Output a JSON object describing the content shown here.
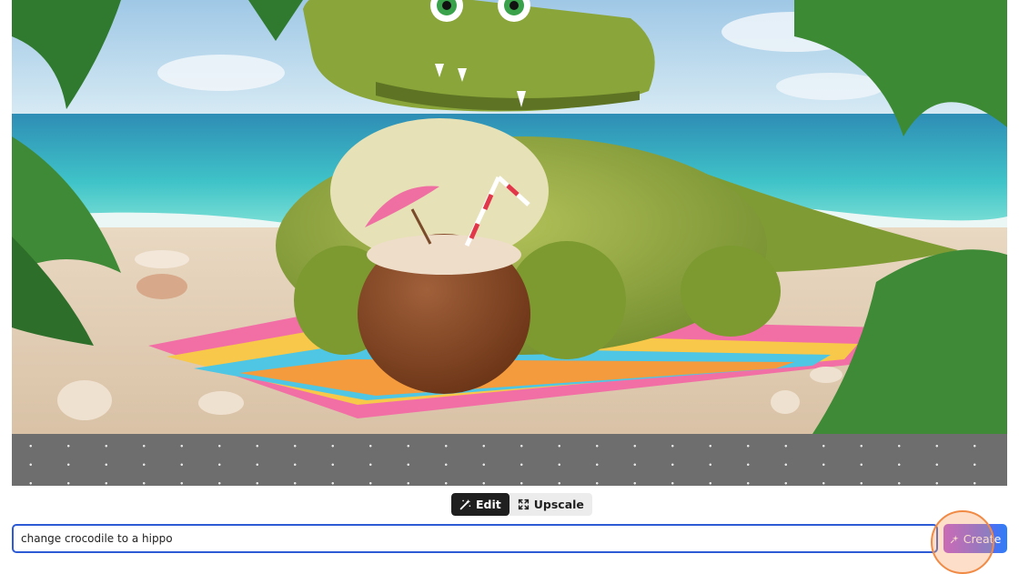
{
  "toolbar": {
    "edit_label": "Edit",
    "upscale_label": "Upscale",
    "edit_icon": "magic-wand-icon",
    "upscale_icon": "expand-icon"
  },
  "prompt": {
    "value": "change crocodile to a hippo"
  },
  "create": {
    "label": "Create",
    "icon": "sparkle-icon"
  },
  "colors": {
    "accent_border": "#2d5bd6",
    "create_gradient_start": "#b34ee0",
    "create_gradient_end": "#2f7ef5",
    "click_highlight": "#f08a44"
  }
}
